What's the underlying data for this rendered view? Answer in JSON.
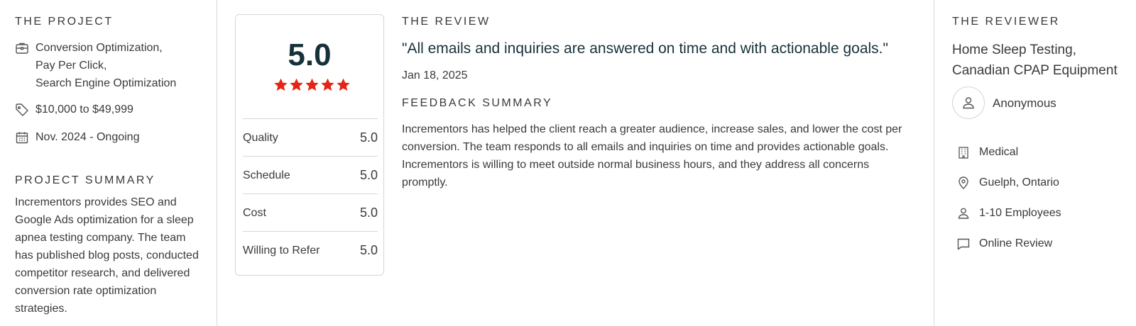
{
  "project": {
    "heading": "THE PROJECT",
    "services": [
      "Conversion Optimization,",
      "Pay Per Click,",
      "Search Engine Optimization"
    ],
    "budget": "$10,000 to $49,999",
    "timeline": "Nov. 2024 - Ongoing",
    "summary_heading": "PROJECT SUMMARY",
    "summary": "Incrementors provides SEO and Google Ads optimization for a sleep apnea testing company. The team has published blog posts, conducted competitor research, and delivered conversion rate optimization strategies."
  },
  "rating": {
    "overall": "5.0",
    "stars": 5,
    "star_color": "#e62415",
    "rows": [
      {
        "label": "Quality",
        "value": "5.0"
      },
      {
        "label": "Schedule",
        "value": "5.0"
      },
      {
        "label": "Cost",
        "value": "5.0"
      },
      {
        "label": "Willing to Refer",
        "value": "5.0"
      }
    ]
  },
  "review": {
    "heading": "THE REVIEW",
    "quote": "\"All emails and inquiries are answered on time and with actionable goals.\"",
    "date": "Jan 18, 2025",
    "feedback_heading": "FEEDBACK SUMMARY",
    "feedback": "Incrementors has helped the client reach a greater audience, increase sales, and lower the cost per conversion. The team responds to all emails and inquiries on time and provides actionable goals. Incrementors is willing to meet outside normal business hours, and they address all concerns promptly."
  },
  "reviewer": {
    "heading": "THE REVIEWER",
    "company_line1": "Home Sleep Testing,",
    "company_line2": "Canadian CPAP Equipment",
    "name": "Anonymous",
    "industry": "Medical",
    "location": "Guelph, Ontario",
    "size": "1-10 Employees",
    "review_type": "Online Review"
  },
  "icons": {
    "services": "briefcase-icon",
    "budget": "tag-icon",
    "timeline": "calendar-icon",
    "industry": "building-icon",
    "location": "location-pin-icon",
    "size": "person-icon",
    "review_type": "chat-bubble-icon",
    "avatar": "user-icon"
  }
}
